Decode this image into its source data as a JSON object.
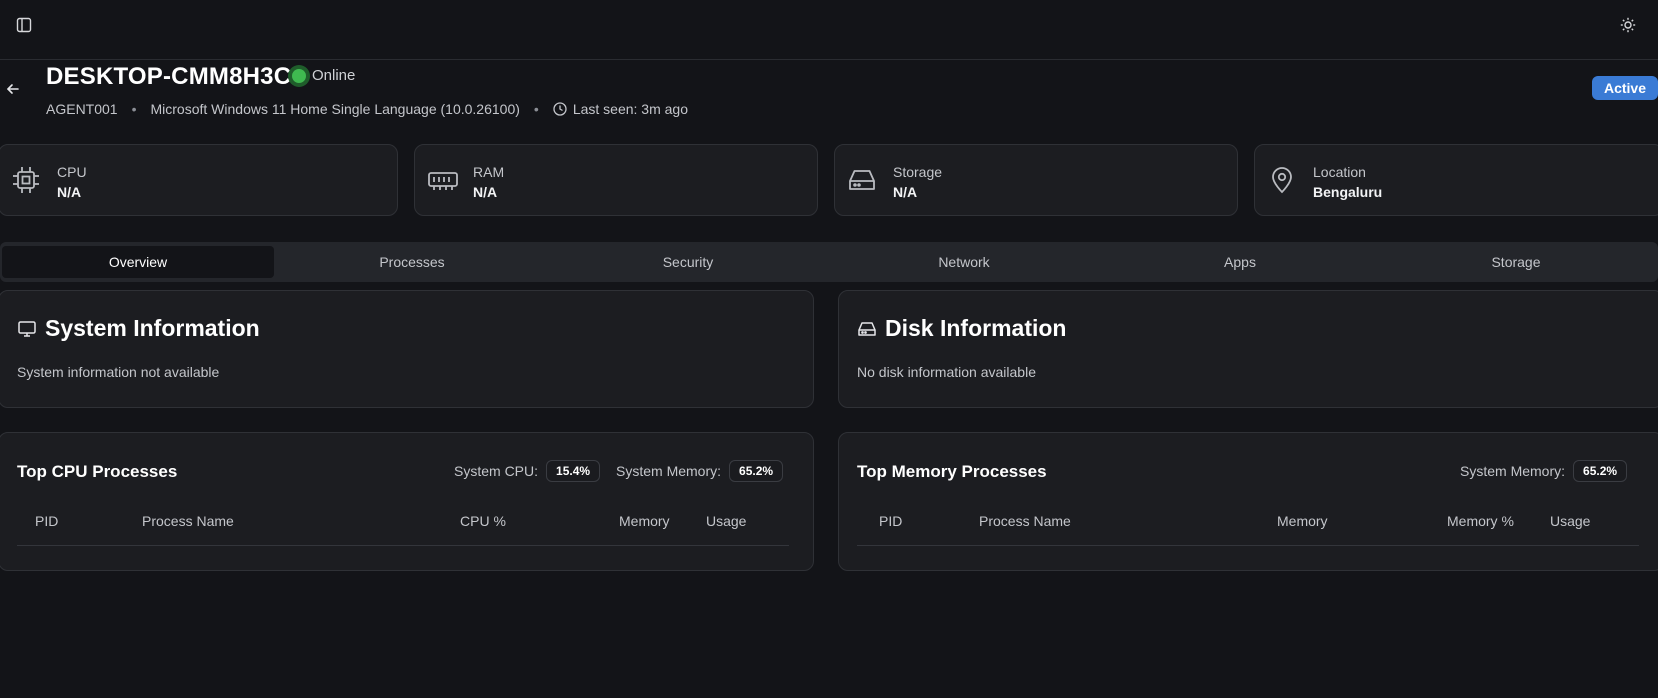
{
  "header": {
    "hostname": "DESKTOP-CMM8H3C",
    "status": "Online",
    "agent_id": "AGENT001",
    "separator": "•",
    "os": "Microsoft Windows 11 Home Single Language (10.0.26100)",
    "last_seen": "Last seen: 3m ago",
    "badge": "Active"
  },
  "stats": [
    {
      "label": "CPU",
      "value": "N/A",
      "icon": "cpu-icon"
    },
    {
      "label": "RAM",
      "value": "N/A",
      "icon": "memory-icon"
    },
    {
      "label": "Storage",
      "value": "N/A",
      "icon": "hard-drive-icon"
    },
    {
      "label": "Location",
      "value": "Bengaluru",
      "icon": "map-pin-icon"
    }
  ],
  "tabs": [
    "Overview",
    "Processes",
    "Security",
    "Network",
    "Apps",
    "Storage"
  ],
  "active_tab": "Overview",
  "system_info": {
    "title": "System Information",
    "message": "System information not available"
  },
  "disk_info": {
    "title": "Disk Information",
    "message": "No disk information available"
  },
  "top_cpu": {
    "title": "Top CPU Processes",
    "system_cpu_label": "System CPU:",
    "system_cpu_value": "15.4%",
    "system_memory_label": "System Memory:",
    "system_memory_value": "65.2%",
    "columns": [
      "PID",
      "Process Name",
      "CPU %",
      "Memory",
      "Usage"
    ]
  },
  "top_memory": {
    "title": "Top Memory Processes",
    "system_memory_label": "System Memory:",
    "system_memory_value": "65.2%",
    "columns": [
      "PID",
      "Process Name",
      "Memory",
      "Memory %",
      "Usage"
    ]
  },
  "colors": {
    "background": "#131418",
    "card": "#1c1d21",
    "border": "#2f3136",
    "online": "#3fb950",
    "badge": "#3a7bd5"
  }
}
